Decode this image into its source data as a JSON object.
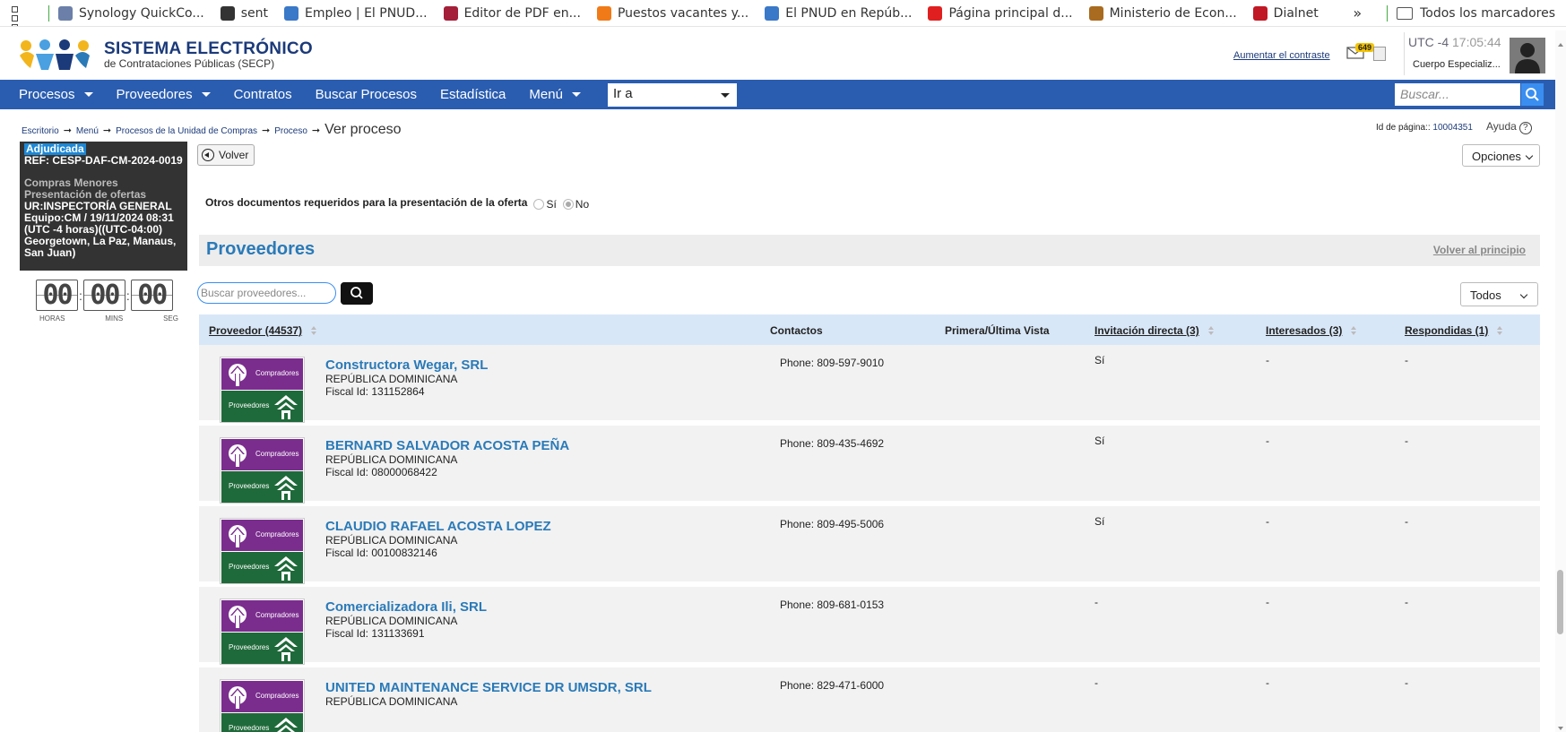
{
  "bookmarks": {
    "items": [
      {
        "label": "Synology QuickCo...",
        "color": "#6b7fa8"
      },
      {
        "label": "sent",
        "color": "#333333"
      },
      {
        "label": "Empleo | El PNUD...",
        "color": "#3a78c8"
      },
      {
        "label": "Editor de PDF en...",
        "color": "#a31f3a"
      },
      {
        "label": "Puestos vacantes y...",
        "color": "#f07a17"
      },
      {
        "label": "El PNUD en Repúb...",
        "color": "#3a78c8"
      },
      {
        "label": "Página principal d...",
        "color": "#e02020"
      },
      {
        "label": "Ministerio de Econ...",
        "color": "#a86b1f"
      },
      {
        "label": "Dialnet",
        "color": "#c01824"
      }
    ],
    "more": "»",
    "folder_label": "Todos los marcadores"
  },
  "header": {
    "logo_title": "SISTEMA ELECTRÓNICO",
    "logo_subtitle": "de Contrataciones Públicas (SECP)",
    "contrast_link": "Aumentar el contraste",
    "mail_badge": "649",
    "utc_zone": "UTC -4",
    "utc_time": "17:05:44",
    "user_org": "Cuerpo Especializ..."
  },
  "nav": {
    "items": [
      "Procesos",
      "Proveedores",
      "Contratos",
      "Buscar Procesos",
      "Estadística",
      "Menú"
    ],
    "goto_select": "Ir a",
    "search_placeholder": "Buscar..."
  },
  "breadcrumb": {
    "items": [
      "Escritorio",
      "Menú",
      "Procesos de la Unidad de Compras",
      "Proceso"
    ],
    "current": "Ver proceso",
    "page_id_label": "Id de página::",
    "page_id": "10004351",
    "help": "Ayuda"
  },
  "status": {
    "badge": "Adjudicada",
    "ref": "REF: CESP-DAF-CM-2024-0019",
    "type": "Compras Menores",
    "phase": "Presentación de ofertas",
    "details": "UR:INSPECTORÍA GENERAL Equipo:CM / 19/11/2024 08:31 (UTC -4 horas)((UTC-04:00) Georgetown, La Paz, Manaus, San Juan)"
  },
  "timer": {
    "hours": "00",
    "mins": "00",
    "secs": "00",
    "hours_label": "HORAS",
    "mins_label": "MINS",
    "secs_label": "SEG"
  },
  "actions": {
    "back": "Volver",
    "options": "Opciones"
  },
  "other_docs": {
    "label": "Otros documentos requeridos para la presentación de la oferta",
    "yes": "Sí",
    "no": "No",
    "selected": "No"
  },
  "section": {
    "title": "Proveedores",
    "back_top": "Volver al principio",
    "search_placeholder": "Buscar proveedores...",
    "filter": "Todos"
  },
  "table": {
    "columns": {
      "provider": "Proveedor (44537)",
      "contacts": "Contactos",
      "first_last_view": "Primera/Última Vista",
      "direct_invite": "Invitación directa (3)",
      "interested": "Interesados (3)",
      "responded": "Respondidas (1)"
    },
    "logo_top": "Compradores",
    "logo_bottom": "Proveedores",
    "rows": [
      {
        "name": "Constructora Wegar, SRL",
        "country": "REPÚBLICA DOMINICANA",
        "fiscal": "Fiscal Id: 131152864",
        "phone": "Phone: 809-597-9010",
        "invite": "Sí",
        "interested": "-",
        "responded": "-"
      },
      {
        "name": "BERNARD SALVADOR ACOSTA PEÑA",
        "country": "REPÚBLICA DOMINICANA",
        "fiscal": "Fiscal Id: 08000068422",
        "phone": "Phone: 809-435-4692",
        "invite": "Sí",
        "interested": "-",
        "responded": "-"
      },
      {
        "name": "CLAUDIO RAFAEL ACOSTA LOPEZ",
        "country": "REPÚBLICA DOMINICANA",
        "fiscal": "Fiscal Id: 00100832146",
        "phone": "Phone: 809-495-5006",
        "invite": "Sí",
        "interested": "-",
        "responded": "-"
      },
      {
        "name": "Comercializadora Ili, SRL",
        "country": "REPÚBLICA DOMINICANA",
        "fiscal": "Fiscal Id: 131133691",
        "phone": "Phone: 809-681-0153",
        "invite": "-",
        "interested": "-",
        "responded": "-"
      },
      {
        "name": "UNITED MAINTENANCE SERVICE DR UMSDR, SRL",
        "country": "REPÚBLICA DOMINICANA",
        "fiscal": "",
        "phone": "Phone: 829-471-6000",
        "invite": "-",
        "interested": "-",
        "responded": "-"
      }
    ]
  }
}
